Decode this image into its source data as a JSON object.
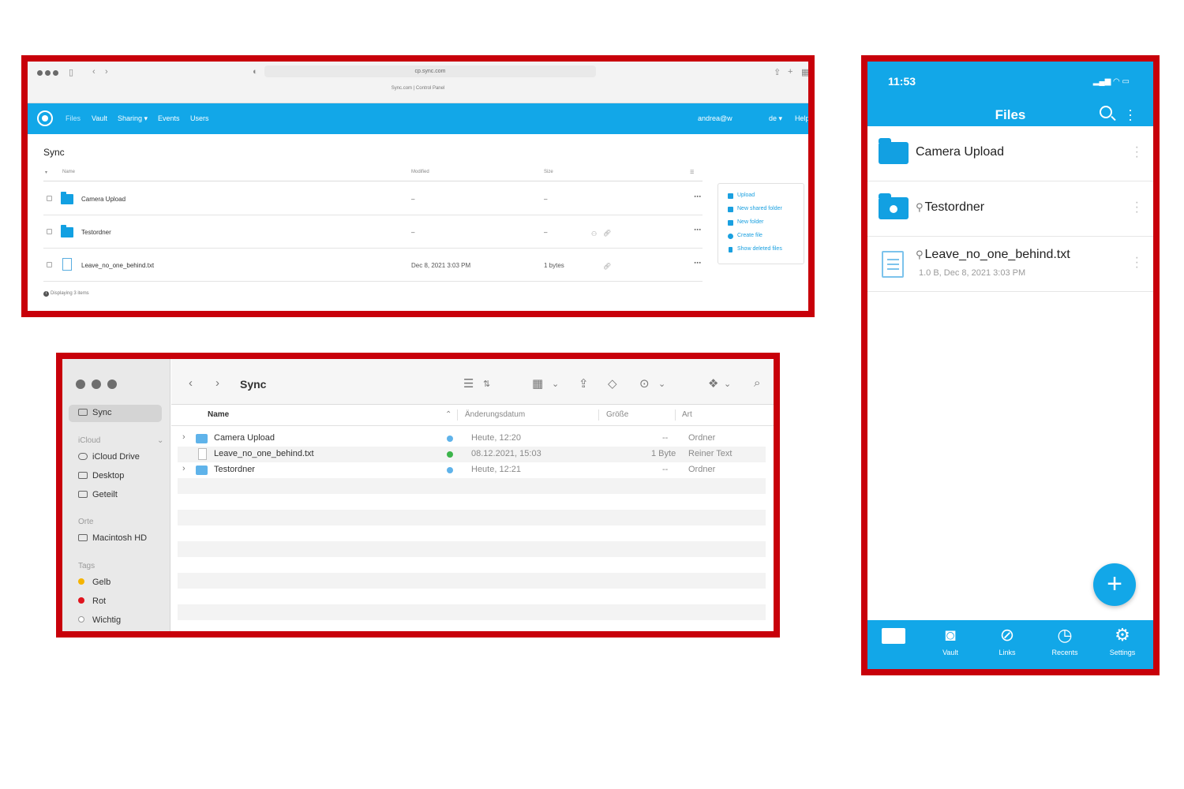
{
  "web": {
    "url": "cp.sync.com",
    "tab_title": "Sync.com | Control Panel",
    "nav": [
      {
        "label": "Files"
      },
      {
        "label": "Vault"
      },
      {
        "label": "Sharing ▾"
      },
      {
        "label": "Events"
      },
      {
        "label": "Users"
      }
    ],
    "user": "andrea@w",
    "lang": "de ▾",
    "help": "Help",
    "title": "Sync",
    "columns": {
      "name": "Name",
      "modified": "Modified",
      "size": "Size"
    },
    "rows": [
      {
        "name": "Camera Upload",
        "modified": "–",
        "size": "–",
        "type": "folder"
      },
      {
        "name": "Testordner",
        "modified": "–",
        "size": "–",
        "type": "shared-folder"
      },
      {
        "name": "Leave_no_one_behind.txt",
        "modified": "Dec 8, 2021 3:03 PM",
        "size": "1 bytes",
        "type": "file"
      }
    ],
    "actions": [
      {
        "label": "Upload"
      },
      {
        "label": "New shared folder"
      },
      {
        "label": "New folder"
      },
      {
        "label": "Create file"
      },
      {
        "label": "Show deleted files"
      }
    ],
    "footer": "Displaying 3 items"
  },
  "finder": {
    "title": "Sync",
    "sidebar": {
      "favorite": "Sync",
      "icloud_header": "iCloud",
      "icloud_items": [
        "iCloud Drive",
        "Desktop",
        "Geteilt"
      ],
      "places_header": "Orte",
      "places_items": [
        "Macintosh HD"
      ],
      "tags_header": "Tags",
      "tags": [
        {
          "label": "Gelb",
          "color": "#f5b400"
        },
        {
          "label": "Rot",
          "color": "#e0141e"
        },
        {
          "label": "Wichtig",
          "color": "#ffffff"
        }
      ]
    },
    "columns": {
      "name": "Name",
      "date": "Änderungsdatum",
      "size": "Größe",
      "kind": "Art"
    },
    "rows": [
      {
        "name": "Camera Upload",
        "date": "Heute, 12:20",
        "size": "--",
        "kind": "Ordner",
        "type": "folder",
        "status_color": "#5fb3ea"
      },
      {
        "name": "Leave_no_one_behind.txt",
        "date": "08.12.2021, 15:03",
        "size": "1 Byte",
        "kind": "Reiner Text",
        "type": "file",
        "status_color": "#3cb44b"
      },
      {
        "name": "Testordner",
        "date": "Heute, 12:21",
        "size": "--",
        "kind": "Ordner",
        "type": "folder",
        "status_color": "#5fb3ea"
      }
    ]
  },
  "mobile": {
    "time": "11:53",
    "title": "Files",
    "items": [
      {
        "name": "Camera Upload",
        "type": "folder"
      },
      {
        "name": "Testordner",
        "type": "shared-folder",
        "linked": true
      },
      {
        "name": "Leave_no_one_behind.txt",
        "type": "file",
        "linked": true,
        "meta": "1.0 B, Dec 8, 2021 3:03 PM"
      }
    ],
    "tabs": [
      {
        "label": "",
        "icon": "folder-icon"
      },
      {
        "label": "Vault",
        "icon": "vault-icon"
      },
      {
        "label": "Links",
        "icon": "link-icon"
      },
      {
        "label": "Recents",
        "icon": "clock-icon"
      },
      {
        "label": "Settings",
        "icon": "gear-icon"
      }
    ]
  },
  "colors": {
    "frame": "#c8000a",
    "brand_blue": "#12a7e8"
  }
}
